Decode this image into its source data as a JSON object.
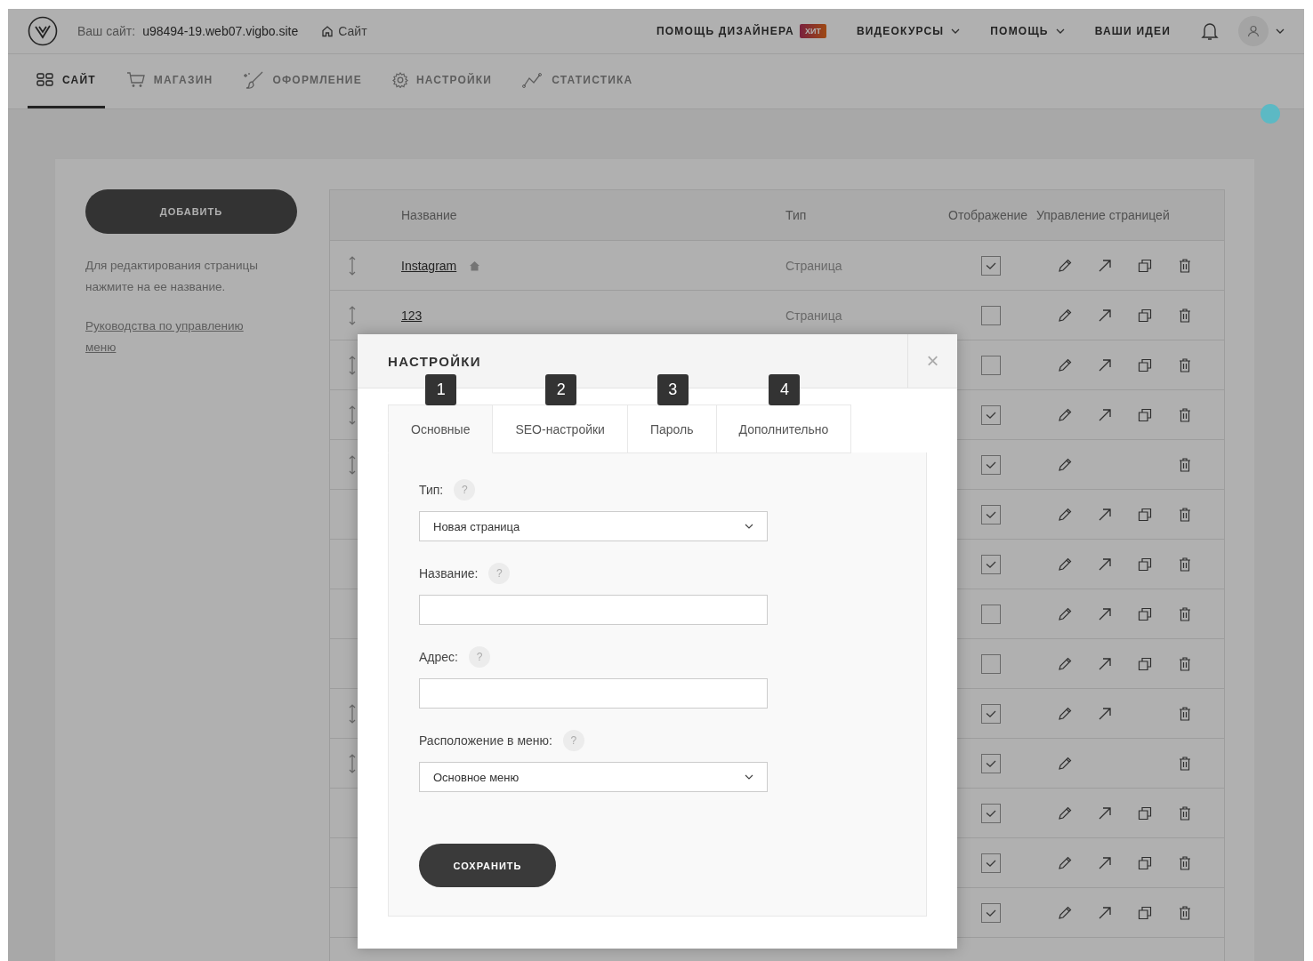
{
  "header": {
    "site_label": "Ваш сайт:",
    "site_url": "u98494-19.web07.vigbo.site",
    "site_link": "Сайт",
    "menu": [
      {
        "label": "ПОМОЩЬ ДИЗАЙНЕРА",
        "badge": "ХИТ",
        "dropdown": false
      },
      {
        "label": "ВИДЕОКУРСЫ",
        "dropdown": true
      },
      {
        "label": "ПОМОЩЬ",
        "dropdown": true
      },
      {
        "label": "ВАШИ ИДЕИ",
        "dropdown": false
      }
    ]
  },
  "nav_tabs": [
    {
      "label": "САЙТ",
      "selected": true
    },
    {
      "label": "МАГАЗИН",
      "selected": false
    },
    {
      "label": "ОФОРМЛЕНИЕ",
      "selected": false
    },
    {
      "label": "НАСТРОЙКИ",
      "selected": false
    },
    {
      "label": "СТАТИСТИКА",
      "selected": false
    }
  ],
  "sidebar": {
    "add_button": "ДОБАВИТЬ",
    "hint": "Для редактирования страницы нажмите на ее название.",
    "guide_link": "Руководства по управлению меню"
  },
  "table": {
    "columns": [
      "Название",
      "Тип",
      "Отображение",
      "Управление страницей"
    ],
    "rows": [
      {
        "name": "Instagram",
        "home": true,
        "type": "Страница",
        "draggable": true,
        "visible": true,
        "open": true,
        "copy": true
      },
      {
        "name": "123",
        "home": false,
        "type": "Страница",
        "draggable": true,
        "visible": false,
        "open": true,
        "copy": true
      },
      {
        "draggable": true,
        "visible": false,
        "open": true,
        "copy": true
      },
      {
        "draggable": true,
        "visible": true,
        "open": true,
        "copy": true
      },
      {
        "draggable": true,
        "visible": true,
        "open": false,
        "copy": false
      },
      {
        "draggable": false,
        "visible": true,
        "open": true,
        "copy": true
      },
      {
        "draggable": false,
        "visible": true,
        "open": true,
        "copy": true
      },
      {
        "draggable": false,
        "visible": false,
        "open": true,
        "copy": true
      },
      {
        "draggable": false,
        "visible": false,
        "open": true,
        "copy": true
      },
      {
        "draggable": true,
        "visible": true,
        "open": true,
        "copy": false
      },
      {
        "draggable": true,
        "visible": true,
        "open": false,
        "copy": false
      },
      {
        "draggable": false,
        "visible": true,
        "open": true,
        "copy": true
      },
      {
        "draggable": false,
        "visible": true,
        "open": true,
        "copy": true
      },
      {
        "draggable": false,
        "visible": true,
        "open": true,
        "copy": true
      }
    ]
  },
  "modal": {
    "title": "НАСТРОЙКИ",
    "close": "×",
    "tabs": [
      {
        "label": "Основные",
        "number": "1",
        "selected": true
      },
      {
        "label": "SEO-настройки",
        "number": "2",
        "selected": false
      },
      {
        "label": "Пароль",
        "number": "3",
        "selected": false
      },
      {
        "label": "Дополнительно",
        "number": "4",
        "selected": false
      }
    ],
    "fields": [
      {
        "kind": "select",
        "label": "Тип:",
        "help": "?",
        "value": "Новая страница"
      },
      {
        "kind": "text",
        "label": "Название:",
        "help": "?"
      },
      {
        "kind": "text",
        "label": "Адрес:",
        "help": "?"
      },
      {
        "kind": "select",
        "label": "Расположение в меню:",
        "help": "?",
        "value": "Основное меню"
      }
    ],
    "save_button": "СОХРАНИТЬ"
  }
}
